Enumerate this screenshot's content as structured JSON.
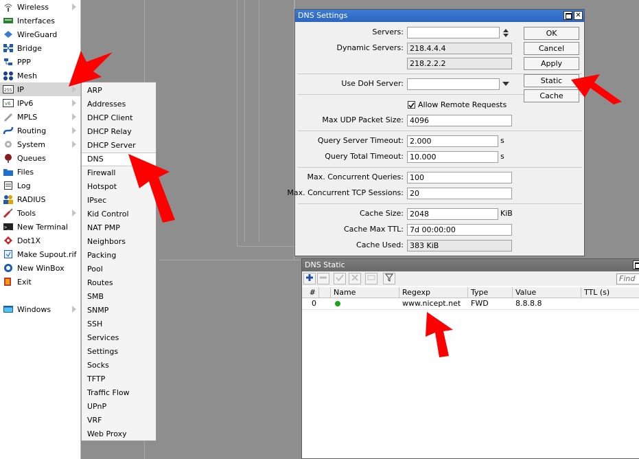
{
  "sidebar": {
    "items": [
      {
        "label": "Wireless",
        "icon": "wireless-icon",
        "submenu": true
      },
      {
        "label": "Interfaces",
        "icon": "interfaces-icon",
        "submenu": false
      },
      {
        "label": "WireGuard",
        "icon": "wireguard-icon",
        "submenu": false
      },
      {
        "label": "Bridge",
        "icon": "bridge-icon",
        "submenu": false
      },
      {
        "label": "PPP",
        "icon": "ppp-icon",
        "submenu": false
      },
      {
        "label": "Mesh",
        "icon": "mesh-icon",
        "submenu": false
      },
      {
        "label": "IP",
        "icon": "ip-icon",
        "submenu": true
      },
      {
        "label": "IPv6",
        "icon": "ipv6-icon",
        "submenu": true
      },
      {
        "label": "MPLS",
        "icon": "mpls-icon",
        "submenu": true
      },
      {
        "label": "Routing",
        "icon": "routing-icon",
        "submenu": true
      },
      {
        "label": "System",
        "icon": "system-icon",
        "submenu": true
      },
      {
        "label": "Queues",
        "icon": "queues-icon",
        "submenu": false
      },
      {
        "label": "Files",
        "icon": "files-icon",
        "submenu": false
      },
      {
        "label": "Log",
        "icon": "log-icon",
        "submenu": false
      },
      {
        "label": "RADIUS",
        "icon": "radius-icon",
        "submenu": false
      },
      {
        "label": "Tools",
        "icon": "tools-icon",
        "submenu": true
      },
      {
        "label": "New Terminal",
        "icon": "terminal-icon",
        "submenu": false
      },
      {
        "label": "Dot1X",
        "icon": "dot1x-icon",
        "submenu": false
      },
      {
        "label": "Make Supout.rif",
        "icon": "supout-icon",
        "submenu": false
      },
      {
        "label": "New WinBox",
        "icon": "winbox-icon",
        "submenu": false
      },
      {
        "label": "Exit",
        "icon": "exit-icon",
        "submenu": false
      },
      {
        "label": "Windows",
        "icon": "windows-icon",
        "submenu": true
      }
    ]
  },
  "ip_submenu": {
    "items": [
      "ARP",
      "Addresses",
      "DHCP Client",
      "DHCP Relay",
      "DHCP Server",
      "DNS",
      "Firewall",
      "Hotspot",
      "IPsec",
      "Kid Control",
      "NAT PMP",
      "Neighbors",
      "Packing",
      "Pool",
      "Routes",
      "SMB",
      "SNMP",
      "SSH",
      "Services",
      "Settings",
      "Socks",
      "TFTP",
      "Traffic Flow",
      "UPnP",
      "VRF",
      "Web Proxy"
    ]
  },
  "dns_settings": {
    "title": "DNS Settings",
    "labels": {
      "servers": "Servers:",
      "dynamic_servers": "Dynamic Servers:",
      "use_doh": "Use DoH Server:",
      "allow_remote": "Allow Remote Requests",
      "max_udp": "Max UDP Packet Size:",
      "query_server_timeout": "Query Server Timeout:",
      "query_total_timeout": "Query Total Timeout:",
      "max_concurrent_queries": "Max. Concurrent Queries:",
      "max_concurrent_tcp": "Max. Concurrent TCP Sessions:",
      "cache_size": "Cache Size:",
      "cache_max_ttl": "Cache Max TTL:",
      "cache_used": "Cache Used:"
    },
    "values": {
      "servers": "",
      "dynamic_server_1": "218.4.4.4",
      "dynamic_server_2": "218.2.2.2",
      "use_doh": "",
      "allow_remote": true,
      "max_udp": "4096",
      "query_server_timeout": "2.000",
      "query_total_timeout": "10.000",
      "max_concurrent_queries": "100",
      "max_concurrent_tcp": "20",
      "cache_size": "2048",
      "cache_max_ttl": "7d 00:00:00",
      "cache_used": "383 KiB"
    },
    "units": {
      "seconds": "s",
      "kib": "KiB"
    },
    "buttons": {
      "ok": "OK",
      "cancel": "Cancel",
      "apply": "Apply",
      "static": "Static",
      "cache": "Cache"
    }
  },
  "dns_static": {
    "title": "DNS Static",
    "find_placeholder": "Find",
    "columns": [
      "#",
      "Name",
      "Regexp",
      "Type",
      "Value",
      "TTL (s)"
    ],
    "rows": [
      {
        "index": "0",
        "name": "",
        "regexp": "www.nicept.net",
        "type": "FWD",
        "value": "8.8.8.8",
        "ttl": ""
      }
    ]
  },
  "colors": {
    "arrow": "#ff0000",
    "titlebar_active": "#2c66c0",
    "titlebar_inactive": "#6a6a6a",
    "status_enabled": "#1aa31a"
  }
}
